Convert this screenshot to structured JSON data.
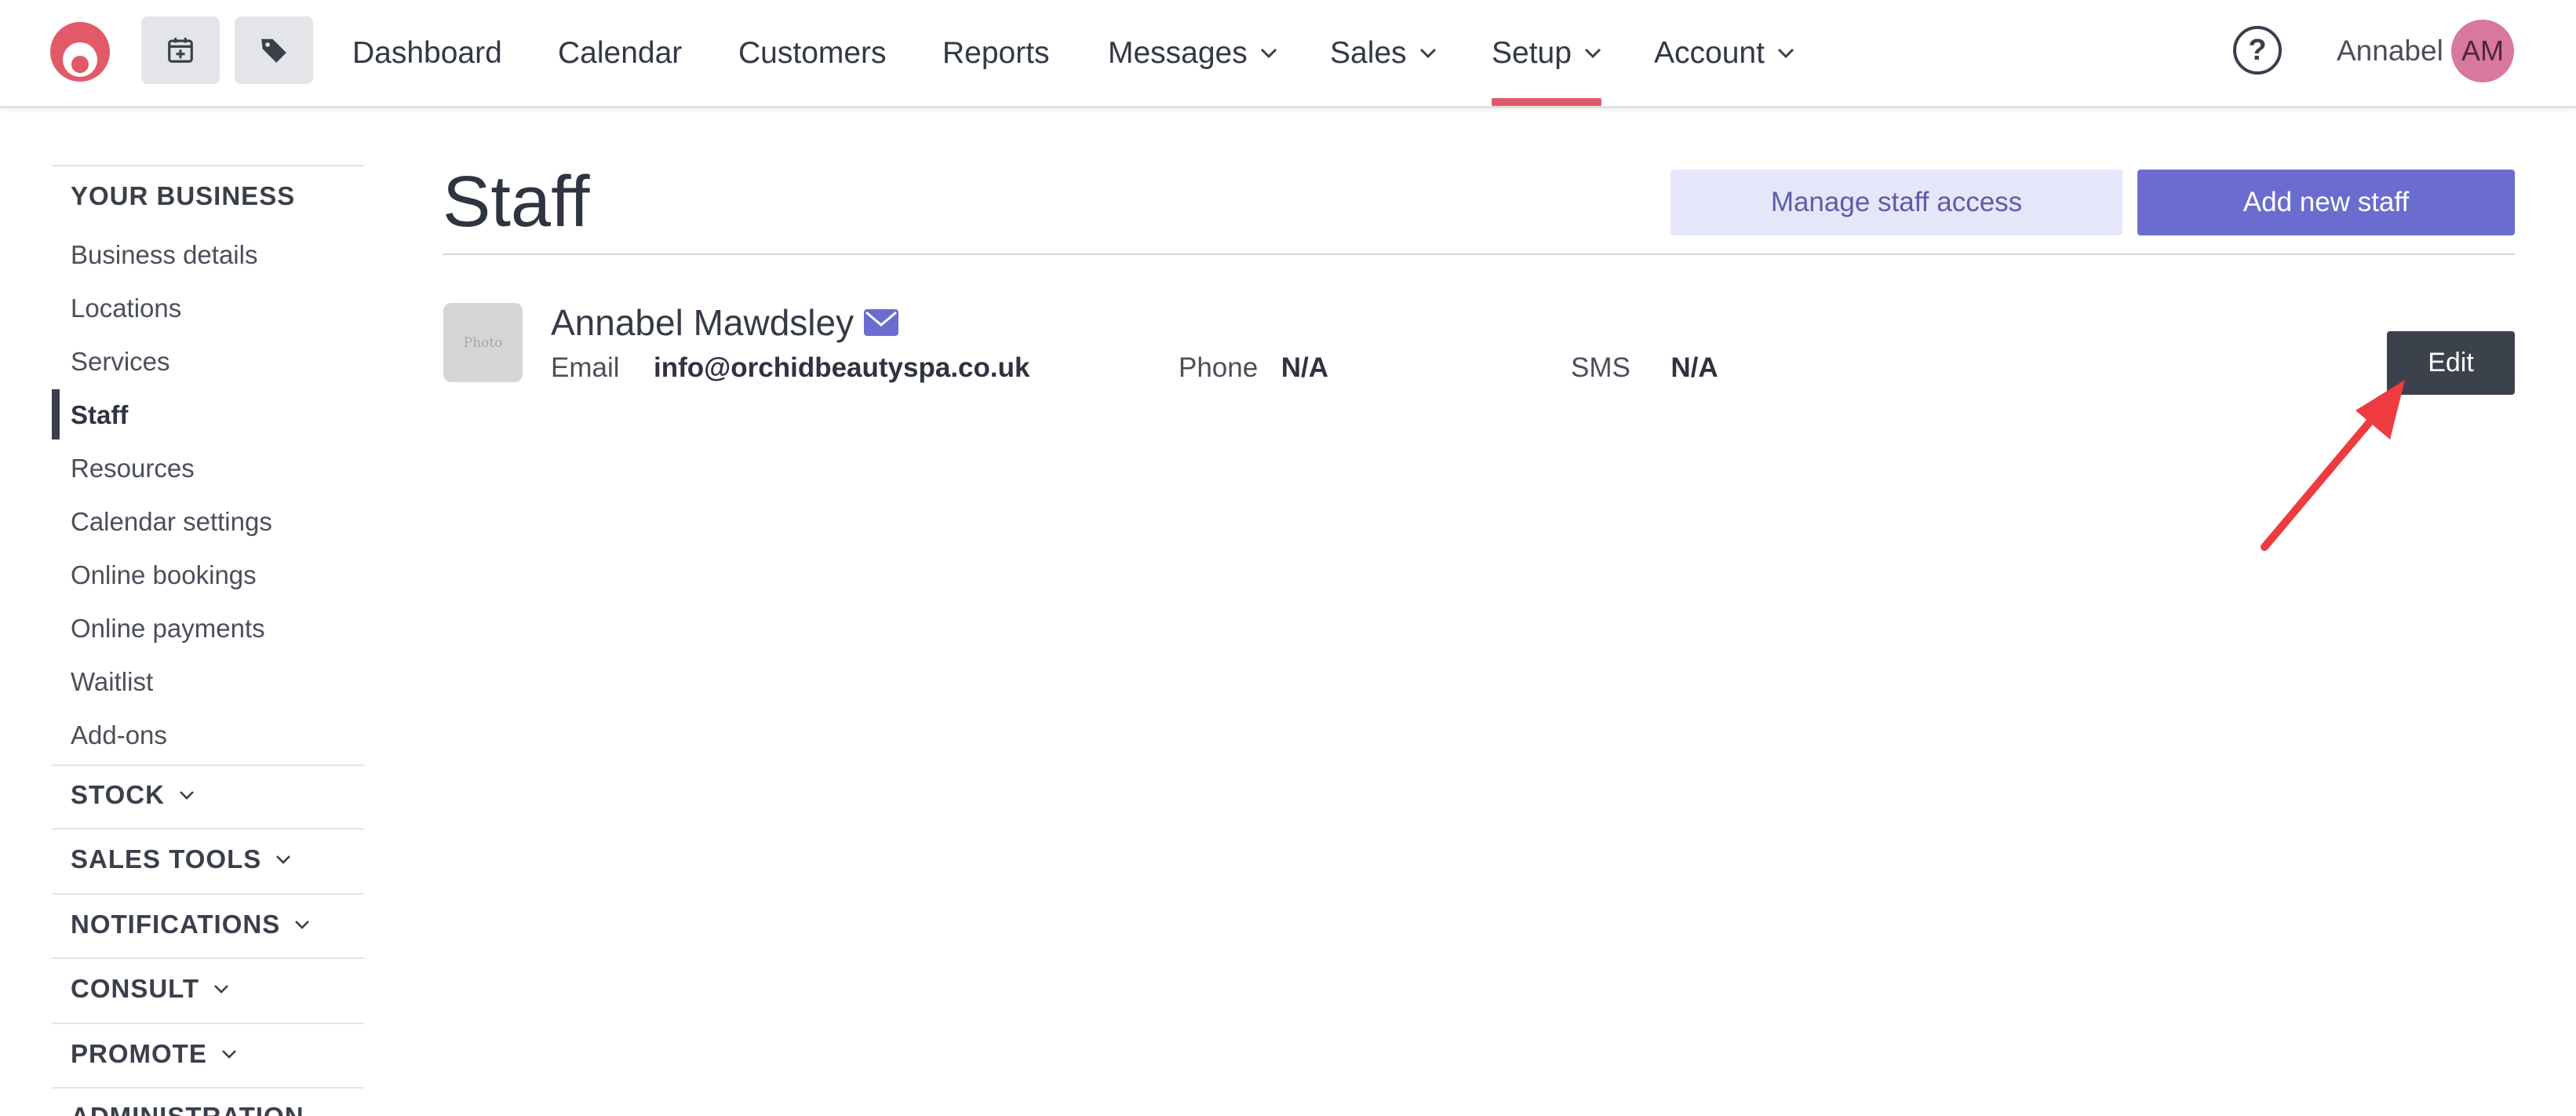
{
  "topbar": {
    "nav": [
      {
        "label": "Dashboard",
        "dropdown": false
      },
      {
        "label": "Calendar",
        "dropdown": false
      },
      {
        "label": "Customers",
        "dropdown": false
      },
      {
        "label": "Reports",
        "dropdown": false
      },
      {
        "label": "Messages",
        "dropdown": true
      },
      {
        "label": "Sales",
        "dropdown": true
      },
      {
        "label": "Setup",
        "dropdown": true,
        "active": true
      },
      {
        "label": "Account",
        "dropdown": true
      }
    ],
    "help_label": "?",
    "user_name": "Annabel",
    "avatar_initials": "AM",
    "accent_color": "#e0596b"
  },
  "sidebar": {
    "section_title": "YOUR BUSINESS",
    "items": [
      {
        "label": "Business details"
      },
      {
        "label": "Locations"
      },
      {
        "label": "Services"
      },
      {
        "label": "Staff",
        "active": true
      },
      {
        "label": "Resources"
      },
      {
        "label": "Calendar settings"
      },
      {
        "label": "Online bookings"
      },
      {
        "label": "Online payments"
      },
      {
        "label": "Waitlist"
      },
      {
        "label": "Add-ons"
      }
    ],
    "groups": [
      {
        "label": "STOCK"
      },
      {
        "label": "SALES TOOLS"
      },
      {
        "label": "NOTIFICATIONS"
      },
      {
        "label": "CONSULT"
      },
      {
        "label": "PROMOTE"
      },
      {
        "label": "ADMINISTRATION"
      }
    ]
  },
  "main": {
    "title": "Staff",
    "manage_button": "Manage staff access",
    "add_button": "Add new staff",
    "staff": {
      "photo_placeholder": "Photo",
      "name": "Annabel Mawdsley",
      "email_label": "Email",
      "email_value": "info@orchidbeautyspa.co.uk",
      "phone_label": "Phone",
      "phone_value": "N/A",
      "sms_label": "SMS",
      "sms_value": "N/A",
      "edit_button": "Edit"
    },
    "primary_color": "#6b6ccf",
    "annotation_color": "#ee3b40"
  }
}
